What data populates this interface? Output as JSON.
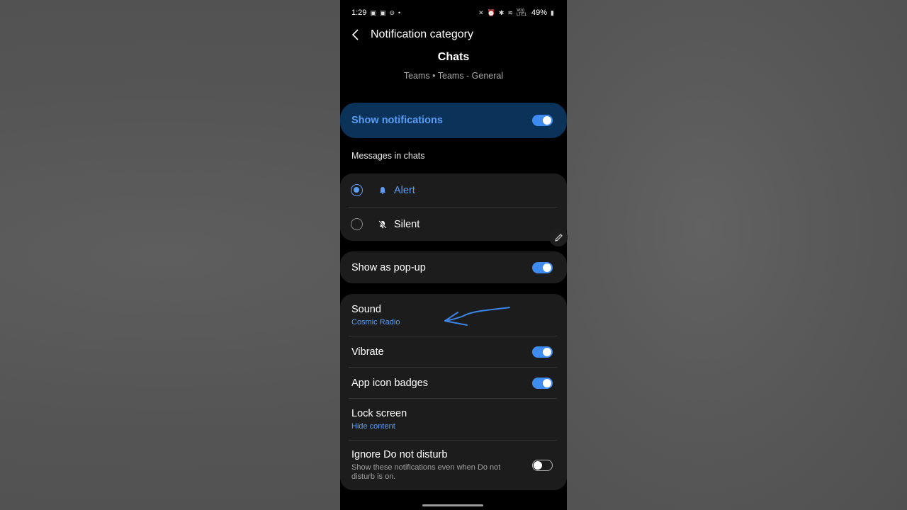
{
  "status_bar": {
    "time": "1:29",
    "battery": "49%",
    "left_icons": [
      "screenshot-icon",
      "screenshot-icon",
      "do-not-disturb-icon",
      "dot-icon"
    ],
    "right_icons": [
      "mute-icon",
      "alarm-icon",
      "bluetooth-icon",
      "wifi-icon",
      "volte-signal-icon",
      "battery-icon"
    ],
    "volte": "Vo)) LTE1"
  },
  "header": {
    "title": "Notification category",
    "back_icon": "chevron-left-icon"
  },
  "category": {
    "name": "Chats",
    "path": "Teams • Teams - General"
  },
  "show_notifications": {
    "label": "Show notifications",
    "enabled": true
  },
  "messages_section": {
    "label": "Messages in chats",
    "options": [
      {
        "label": "Alert",
        "icon": "bell-icon",
        "selected": true
      },
      {
        "label": "Silent",
        "icon": "bell-off-icon",
        "selected": false
      }
    ]
  },
  "popup": {
    "label": "Show as pop-up",
    "enabled": true
  },
  "settings": {
    "sound": {
      "label": "Sound",
      "value": "Cosmic Radio"
    },
    "vibrate": {
      "label": "Vibrate",
      "enabled": true
    },
    "badges": {
      "label": "App icon badges",
      "enabled": true
    },
    "lock_screen": {
      "label": "Lock screen",
      "value": "Hide content"
    },
    "ignore_dnd": {
      "label": "Ignore Do not disturb",
      "description": "Show these notifications even when Do not disturb is on.",
      "enabled": false
    }
  },
  "colors": {
    "accent": "#5b9df5",
    "toggle_on": "#3e8cf0",
    "highlight_bg": "#0b3258",
    "card_bg": "#1c1c1c",
    "annotation": "#3a86e8"
  },
  "annotation": {
    "icon": "hand-drawn-arrow-icon"
  }
}
